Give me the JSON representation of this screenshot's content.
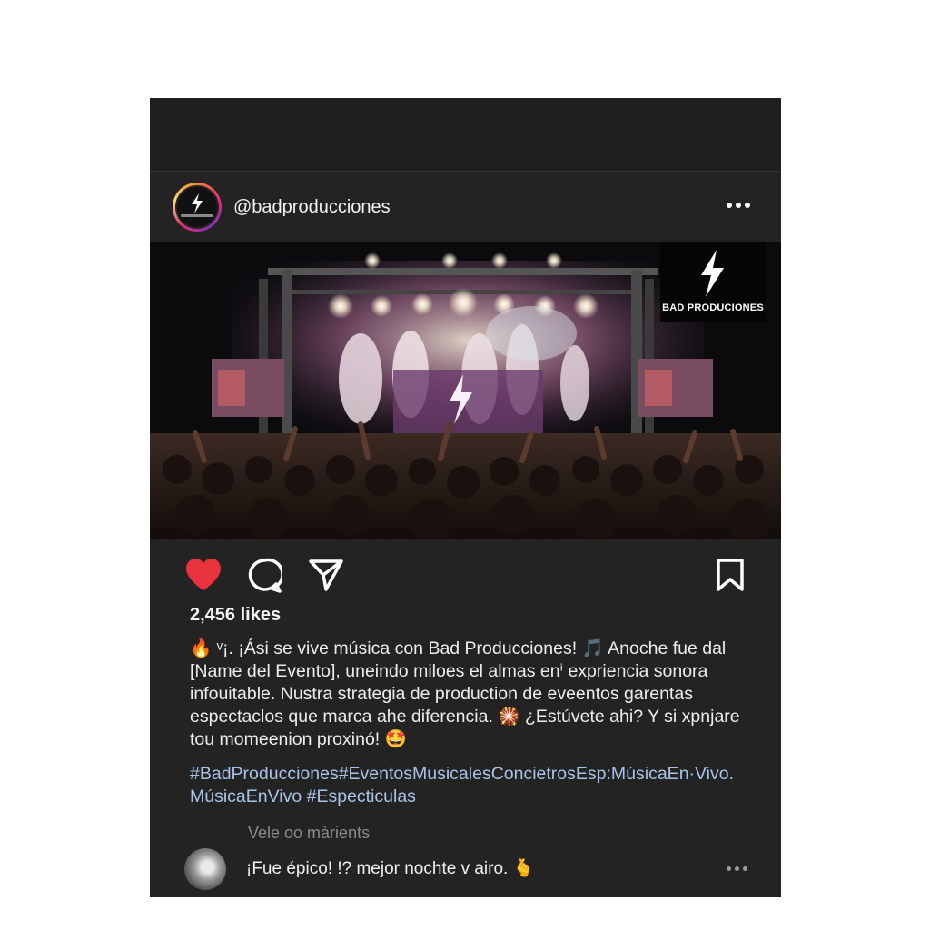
{
  "post": {
    "username": "@badproducciones",
    "brand_logo_text": "BAD PRODUCIONES",
    "likes": "2,456 likes",
    "caption_lines": [
      "🔥 ᵛ¡. ¡Ási se vive música con Bad Producciones! 🎵 Anoche fue dal",
      "[Name del Evento], uneindo miloes el almas enⁱ expriencia sonora",
      "infouitable. Nustra strategia de production de eveentos garentas",
      "espectaclos que marca ahe diferencia. 🎇 ¿Estúvete ahi? Y si xpnjare",
      "tou momeenion proxinó! 🤩"
    ],
    "hashtag_lines": [
      "#BadProducciones#EventosMusicalesConcietrosEsp:MúsicaEn·Vivo.",
      "MúsicaEnVivo #Especticulas"
    ],
    "view_comments": "Vele oo màrients",
    "comment": {
      "text": "¡Fue épico! !? mejor nochte v airo. 🫰"
    },
    "colors": {
      "background": "#232323",
      "like_heart": "#e8323c",
      "hashtag": "#a7c4e8"
    },
    "icons": [
      "lightning-bolt-icon",
      "more-options-icon",
      "heart-icon",
      "comment-icon",
      "share-icon",
      "bookmark-icon"
    ]
  }
}
